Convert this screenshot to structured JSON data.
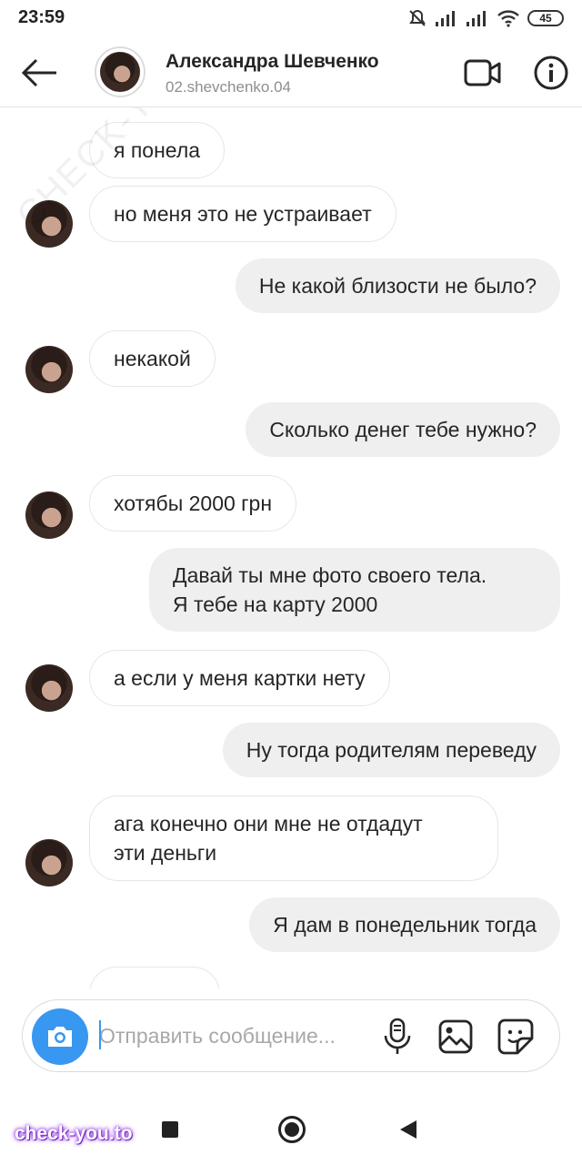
{
  "status_bar": {
    "time": "23:59",
    "battery": "45"
  },
  "header": {
    "name": "Александра Шевченко",
    "username": "02.shevchenko.04"
  },
  "watermarks": {
    "diagonal": "CHECK-YOU.ME",
    "brand": "check-you.to"
  },
  "messages": [
    {
      "side": "in",
      "text": "я понела"
    },
    {
      "side": "in",
      "text": "но меня это не устраивает"
    },
    {
      "side": "out",
      "text": "Не какой близости не было?"
    },
    {
      "side": "in",
      "text": "некакой"
    },
    {
      "side": "out",
      "text": "Сколько денег тебе нужно?"
    },
    {
      "side": "in",
      "text": "хотябы 2000 грн"
    },
    {
      "side": "out",
      "line1": "Давай ты мне фото своего тела.",
      "line2": "Я тебе на карту 2000"
    },
    {
      "side": "in",
      "text": "а если у меня картки нету"
    },
    {
      "side": "out",
      "text": "Ну тогда родителям переведу"
    },
    {
      "side": "in",
      "line1": "ага конечно они мне не отдадут",
      "line2": "эти деньги"
    },
    {
      "side": "out",
      "text": "Я дам в понедельник тогда"
    }
  ],
  "composer": {
    "placeholder": "Отправить сообщение..."
  },
  "colors": {
    "accent": "#3897f0",
    "bubble_out": "#efefef",
    "bubble_in_border": "#e6e6e6"
  }
}
